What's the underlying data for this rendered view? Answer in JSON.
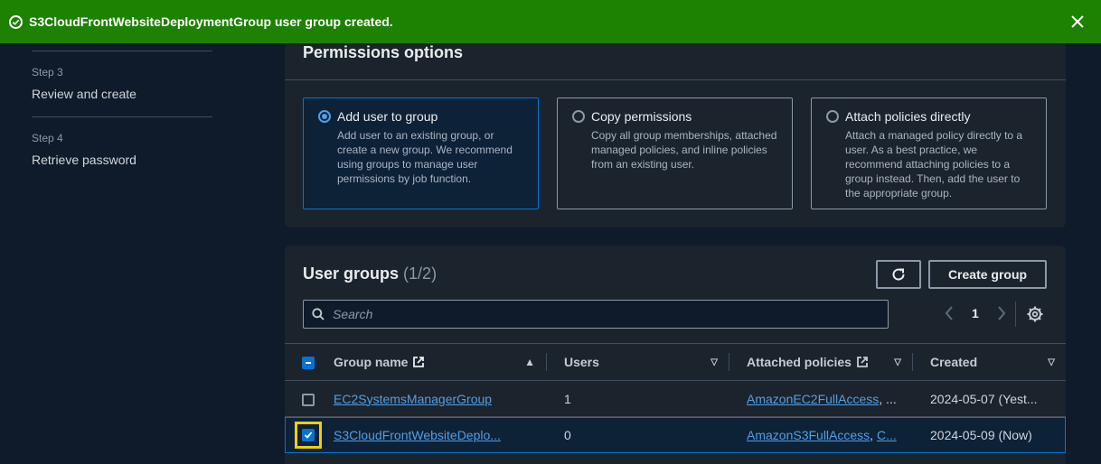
{
  "flash": {
    "message": "S3CloudFrontWebsiteDeploymentGroup user group created.",
    "color": "#1d8102"
  },
  "steps": [
    {
      "number": "Step 3",
      "title": "Review and create"
    },
    {
      "number": "Step 4",
      "title": "Retrieve password"
    }
  ],
  "permissions": {
    "heading": "Permissions options",
    "options": [
      {
        "title": "Add user to group",
        "description": "Add user to an existing group, or create a new group. We recommend using groups to manage user permissions by job function.",
        "selected": true
      },
      {
        "title": "Copy permissions",
        "description": "Copy all group memberships, attached managed policies, and inline policies from an existing user.",
        "selected": false
      },
      {
        "title": "Attach policies directly",
        "description": "Attach a managed policy directly to a user. As a best practice, we recommend attaching policies to a group instead. Then, add the user to the appropriate group.",
        "selected": false
      }
    ]
  },
  "groups": {
    "title": "User groups",
    "count": "(1/2)",
    "create_label": "Create group",
    "search_placeholder": "Search",
    "page": "1",
    "columns": {
      "name": "Group name",
      "users": "Users",
      "policies": "Attached policies",
      "created": "Created"
    },
    "rows": [
      {
        "name": "EC2SystemsManagerGroup",
        "users": "1",
        "policy1": "AmazonEC2FullAccess",
        "policy_rest": ", ...",
        "created": "2024-05-07 (Yest...",
        "checked": false
      },
      {
        "name": "S3CloudFrontWebsiteDeplo...",
        "users": "0",
        "policy1": "AmazonS3FullAccess",
        "policy_sep": ", ",
        "policy2": "C...",
        "created": "2024-05-09 (Now)",
        "checked": true
      }
    ]
  },
  "colors": {
    "accent": "#0972d3",
    "link": "#539fe5",
    "highlight": "#f2d000",
    "panel": "#1b232d",
    "background": "#0f1b2a"
  }
}
